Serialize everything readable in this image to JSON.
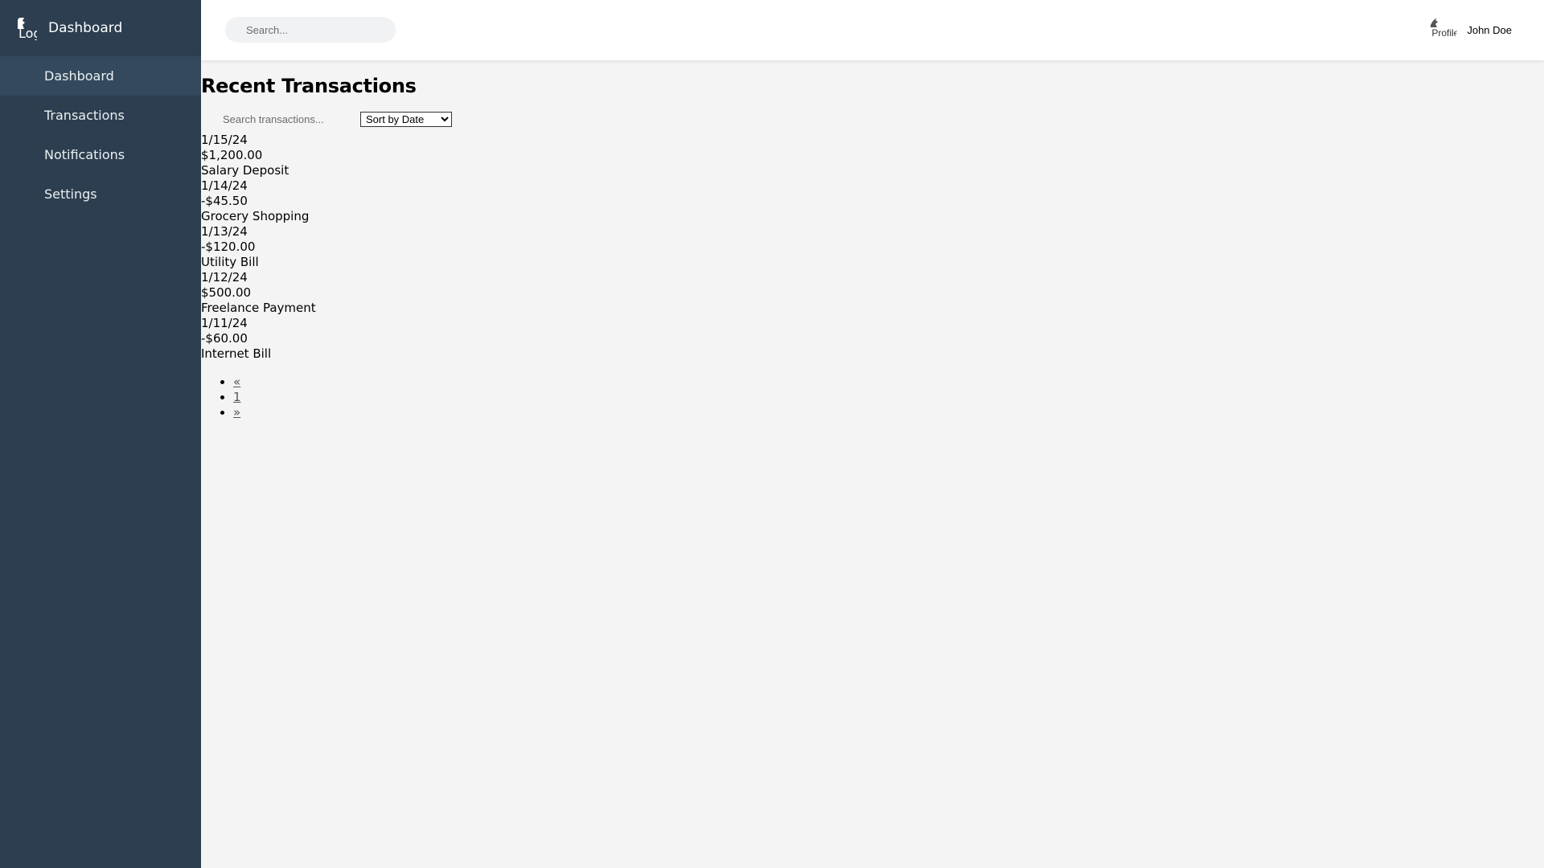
{
  "sidebar": {
    "logo_alt": "Logo",
    "brand": "Dashboard",
    "items": [
      {
        "label": "Dashboard"
      },
      {
        "label": "Transactions"
      },
      {
        "label": "Notifications"
      },
      {
        "label": "Settings"
      }
    ],
    "active_index": 0
  },
  "header": {
    "search_placeholder": "Search...",
    "avatar_alt": "Profile",
    "username": "John Doe"
  },
  "main": {
    "title": "Recent Transactions",
    "filter": {
      "search_placeholder": "Search transactions...",
      "sort_selected": "Sort by Date"
    },
    "transactions": [
      {
        "date": "1/15/24",
        "amount": "$1,200.00",
        "description": "Salary Deposit"
      },
      {
        "date": "1/14/24",
        "amount": "-$45.50",
        "description": "Grocery Shopping"
      },
      {
        "date": "1/13/24",
        "amount": "-$120.00",
        "description": "Utility Bill"
      },
      {
        "date": "1/12/24",
        "amount": "$500.00",
        "description": "Freelance Payment"
      },
      {
        "date": "1/11/24",
        "amount": "-$60.00",
        "description": "Internet Bill"
      }
    ],
    "pagination": {
      "prev": "«",
      "page": "1",
      "next": "»"
    }
  },
  "colors": {
    "sidebar_bg": "#2c3e50",
    "sidebar_active": "#34495e",
    "page_bg": "#f4f4f4"
  }
}
